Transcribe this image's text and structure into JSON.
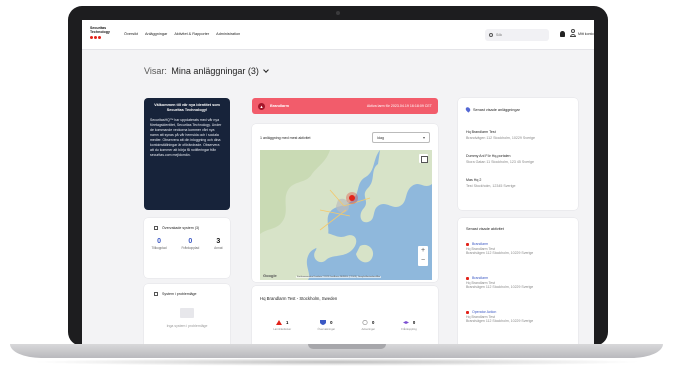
{
  "logo": {
    "text": "Securitas Technology"
  },
  "nav": {
    "links": [
      "Översikt",
      "Anläggningar",
      "Aktivitet & Rapporter",
      "Administration"
    ],
    "search_placeholder": "Sök",
    "account_label": "Mitt konto"
  },
  "heading": {
    "label": "Visar:",
    "value": "Mina anläggningar (3)"
  },
  "welcome": {
    "title": "Välkommen till vår nya identitet som Securitas Technology!",
    "body": "SecuritasHQ™ har uppdaterats med vår nya företagsidentitet, Securitas Technology. Under de kommande veckorna kommer vårt nya namn att synas på vår hemsida och i sociala medier. Observera att din inloggning och dina kontoinställningar är oförändrade. Observera att du kommer att börja få notifieringar från securitas.com mejldomän."
  },
  "monitored": {
    "title": "Övervakade system (3)",
    "stats": [
      {
        "value": "0",
        "label": "Tillkopplad"
      },
      {
        "value": "0",
        "label": "Frånkopplad"
      },
      {
        "value": "3",
        "label": "Annat"
      }
    ]
  },
  "issues": {
    "title": "System i problemläge",
    "empty_text": "Inga system i problemläge"
  },
  "alarm": {
    "type": "Brandlarm",
    "time": "Aktiva larm för 2023.04.19 16:18:09 CET"
  },
  "map_card": {
    "label": "1 anläggning med mest aktivitet",
    "select_value": "Idag",
    "footer": "Kortkommandon   Kartdata ©2023 GeoBasis-DE/BKG (©2009), Google   Användarvillkor",
    "google": "Google"
  },
  "site": {
    "title": "Hq Brandlarm Test - Stockholm, Sweden",
    "counts": [
      {
        "value": "1",
        "label": "Larmhändelser",
        "color": "#e2231a"
      },
      {
        "value": "0",
        "label": "Övervakningar",
        "color": "#3b58c4"
      },
      {
        "value": "0",
        "label": "Aviseringar",
        "color": "#888888"
      },
      {
        "value": "0",
        "label": "Frånkoppling",
        "color": "#7b4fd1"
      }
    ]
  },
  "recent_sites": {
    "title": "Senast visade anläggningar",
    "items": [
      {
        "name": "Hq Brandlarm Test",
        "address": "Brandvägen 112 Stockholm, 10229 Sverige"
      },
      {
        "name": "Dummy Anl För Hq-portalen",
        "address": "Stora Gatan 11 Stockholm, 123 45 Sverige"
      },
      {
        "name": "Mas Hq 2",
        "address": "Test Stockholm, 12345 Sverige"
      }
    ]
  },
  "recent_activity": {
    "title": "Senast visade aktivitet",
    "items": [
      {
        "type": "Brandlarm",
        "name": "Hq Brandlarm Test",
        "address": "Brandvägen 112 Stockholm, 10229 Sverige"
      },
      {
        "type": "Brandlarm",
        "name": "Hq Brandlarm Test",
        "address": "Brandvägen 112 Stockholm, 10229 Sverige"
      },
      {
        "type": "Operator Action",
        "name": "Hq Brandlarm Test",
        "address": "Brandvägen 112 Stockholm, 10229 Sverige"
      }
    ]
  },
  "colors": {
    "brand_red": "#e2231a",
    "navy": "#17233a",
    "alarm": "#f25c6b"
  }
}
